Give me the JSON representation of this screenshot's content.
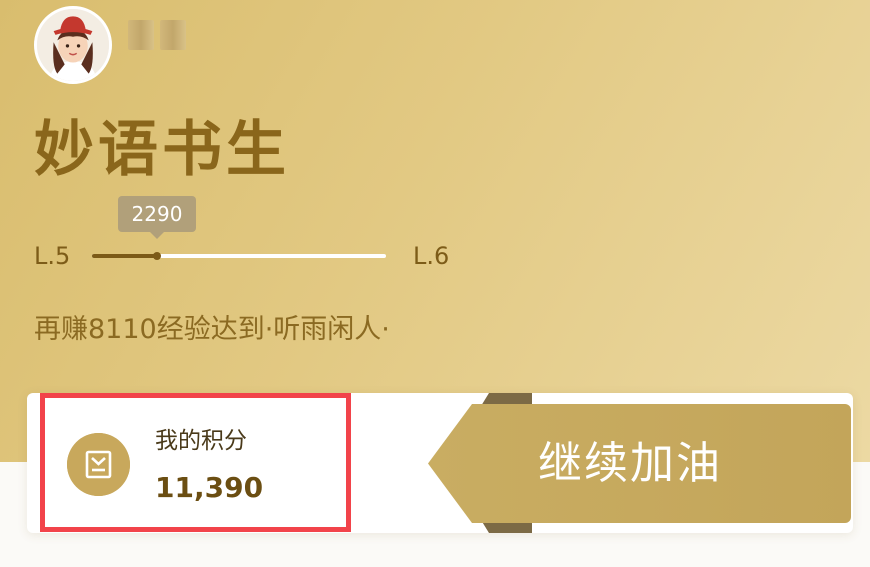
{
  "profile": {
    "rank_title": "妙语书生"
  },
  "level": {
    "xp_current": "2290",
    "current_level": "L.5",
    "next_level": "L.6",
    "progress_fraction": 0.22,
    "hint": "再赚8110经验达到·听雨闲人·"
  },
  "points": {
    "label": "我的积分",
    "value": "11,390"
  },
  "cta": {
    "label": "继续加油"
  },
  "colors": {
    "gold_dark": "#8a661b",
    "gold_button": "#c9ad62",
    "highlight_red": "#f2434a"
  },
  "icons": {
    "avatar": "avatar-girl-red-hat",
    "points": "points-coin-icon"
  }
}
